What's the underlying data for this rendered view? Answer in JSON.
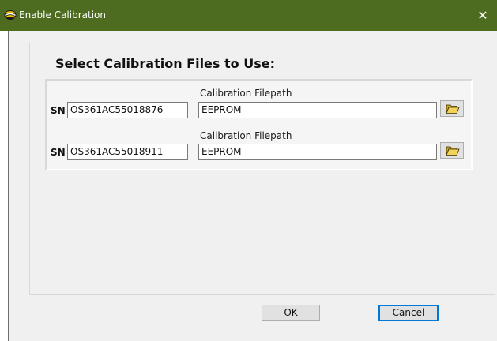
{
  "window": {
    "title": "Enable Calibration",
    "close_glyph": "✕",
    "title_bar_color": "#4d6c1f",
    "icon": "eye-icon"
  },
  "dialog": {
    "heading": "Select Calibration Files to Use:",
    "rows": [
      {
        "sn_label": "SN",
        "sn_value": "OS361AC55018876",
        "filepath_label": "Calibration Filepath",
        "filepath_value": "EEPROM",
        "browse_icon": "folder-open-icon"
      },
      {
        "sn_label": "SN",
        "sn_value": "OS361AC55018911",
        "filepath_label": "Calibration Filepath",
        "filepath_value": "EEPROM",
        "browse_icon": "folder-open-icon"
      }
    ]
  },
  "buttons": {
    "ok_label": "OK",
    "cancel_label": "Cancel"
  }
}
